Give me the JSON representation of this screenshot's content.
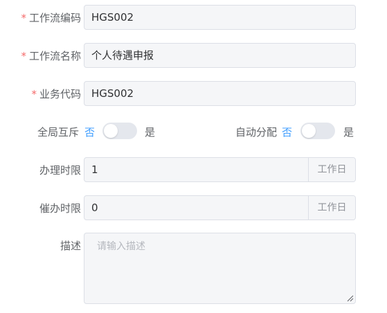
{
  "form": {
    "required_mark": "*",
    "workflow_code": {
      "label": "工作流编码",
      "value": "HGS002"
    },
    "workflow_name": {
      "label": "工作流名称",
      "value": "个人待遇申报"
    },
    "business_code": {
      "label": "业务代码",
      "value": "HGS002"
    },
    "global_mutex": {
      "label": "全局互斥",
      "off_text": "否",
      "on_text": "是",
      "on": false
    },
    "auto_assign": {
      "label": "自动分配",
      "off_text": "否",
      "on_text": "是",
      "on": false
    },
    "handle_limit": {
      "label": "办理时限",
      "value": "1",
      "unit": "工作日"
    },
    "urge_limit": {
      "label": "催办时限",
      "value": "0",
      "unit": "工作日"
    },
    "description": {
      "label": "描述",
      "placeholder": "请输入描述",
      "value": ""
    }
  }
}
